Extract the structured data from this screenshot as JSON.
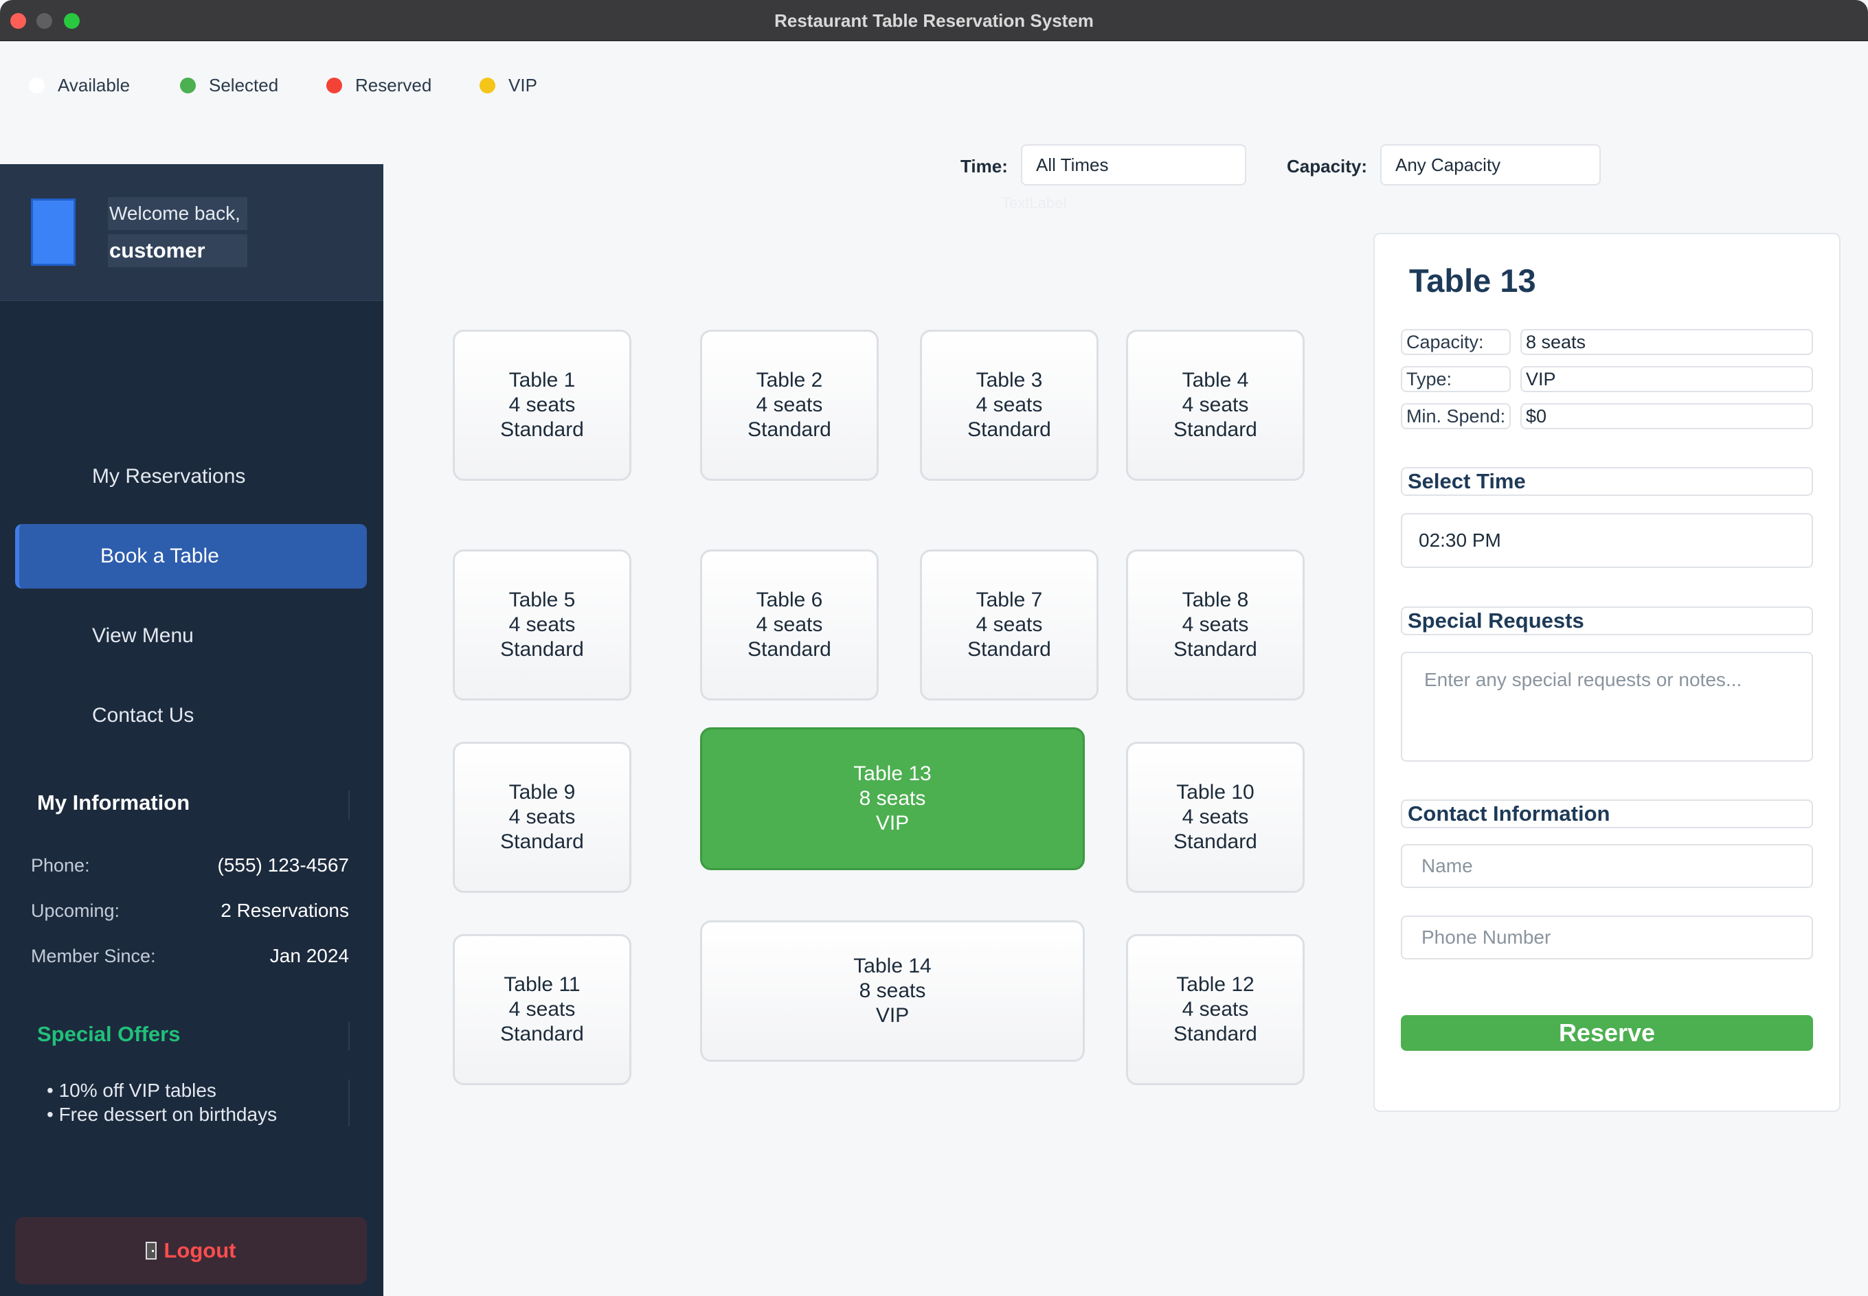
{
  "window": {
    "title": "Restaurant Table Reservation System"
  },
  "legend": [
    {
      "label": "Available",
      "color": "#ffffff"
    },
    {
      "label": "Selected",
      "color": "#4caf50"
    },
    {
      "label": "Reserved",
      "color": "#f44336"
    },
    {
      "label": "VIP",
      "color": "#f5c518"
    }
  ],
  "sidebar": {
    "welcome": "Welcome back,",
    "username": "customer",
    "nav": [
      "My Reservations",
      "Book a Table",
      "View Menu",
      "Contact Us"
    ],
    "active_nav": "Book a Table",
    "info_title": "My Information",
    "info": [
      {
        "label": "Phone:",
        "value": "(555) 123-4567"
      },
      {
        "label": "Upcoming:",
        "value": "2 Reservations"
      },
      {
        "label": "Member Since:",
        "value": "Jan 2024"
      }
    ],
    "offers_title": "Special Offers",
    "offers": [
      "• 10% off VIP tables",
      "• Free dessert on birthdays"
    ],
    "logout_label": "Logout"
  },
  "filters": {
    "time_label": "Time:",
    "time_value": "All Times",
    "capacity_label": "Capacity:",
    "capacity_value": "Any Capacity",
    "ghost_label": "TextLabel"
  },
  "tables": [
    {
      "name": "Table 1",
      "seats": "4 seats",
      "type": "Standard"
    },
    {
      "name": "Table 2",
      "seats": "4 seats",
      "type": "Standard"
    },
    {
      "name": "Table 3",
      "seats": "4 seats",
      "type": "Standard"
    },
    {
      "name": "Table 4",
      "seats": "4 seats",
      "type": "Standard"
    },
    {
      "name": "Table 5",
      "seats": "4 seats",
      "type": "Standard"
    },
    {
      "name": "Table 6",
      "seats": "4 seats",
      "type": "Standard"
    },
    {
      "name": "Table 7",
      "seats": "4 seats",
      "type": "Standard"
    },
    {
      "name": "Table 8",
      "seats": "4 seats",
      "type": "Standard"
    },
    {
      "name": "Table 9",
      "seats": "4 seats",
      "type": "Standard"
    },
    {
      "name": "Table 13",
      "seats": "8 seats",
      "type": "VIP",
      "selected": true
    },
    {
      "name": "Table 10",
      "seats": "4 seats",
      "type": "Standard"
    },
    {
      "name": "Table 11",
      "seats": "4 seats",
      "type": "Standard"
    },
    {
      "name": "Table 14",
      "seats": "8 seats",
      "type": "VIP"
    },
    {
      "name": "Table 12",
      "seats": "4 seats",
      "type": "Standard"
    }
  ],
  "details": {
    "title": "Table 13",
    "specs": [
      {
        "label": "Capacity:",
        "value": "8 seats"
      },
      {
        "label": "Type:",
        "value": "VIP"
      },
      {
        "label": "Min. Spend:",
        "value": "$0"
      }
    ],
    "select_time_title": "Select Time",
    "time_value": "02:30 PM",
    "special_requests_title": "Special Requests",
    "special_requests_placeholder": "Enter any special requests or notes...",
    "contact_title": "Contact Information",
    "name_placeholder": "Name",
    "phone_placeholder": "Phone Number",
    "reserve_label": "Reserve"
  }
}
